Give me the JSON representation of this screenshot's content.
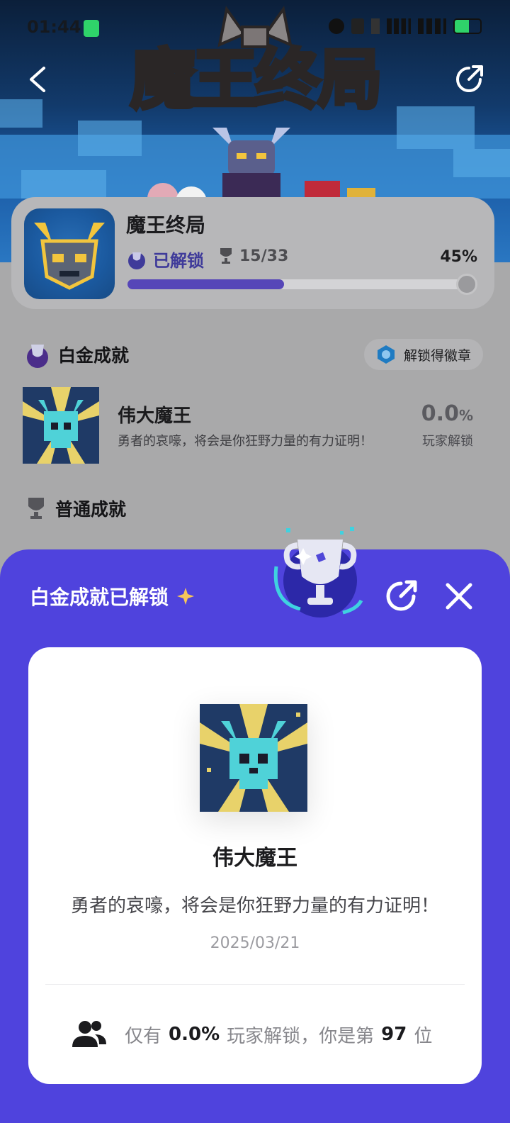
{
  "status_bar": {
    "time": "01:44"
  },
  "hero": {
    "title": "魔王终局"
  },
  "game": {
    "name": "魔王终局",
    "unlocked_label": "已解锁",
    "trophy_count": "15/33",
    "percent": "45%",
    "progress": 0.45
  },
  "platinum_section": {
    "title": "白金成就",
    "badge_button": "解锁得徽章",
    "achievement": {
      "title": "伟大魔王",
      "desc": "勇者的哀嚎，将会是你狂野力量的有力证明！",
      "pct_value": "0.0",
      "pct_unit": "%",
      "pct_label": "玩家解锁"
    }
  },
  "normal_section": {
    "title": "普通成就"
  },
  "modal": {
    "title": "白金成就已解锁",
    "card": {
      "title": "伟大魔王",
      "desc": "勇者的哀嚎，将会是你狂野力量的有力证明！",
      "date": "2025/03/21",
      "foot_prefix": "仅有",
      "foot_pct": "0.0%",
      "foot_mid": "玩家解锁，你是第",
      "foot_rank": "97",
      "foot_suffix": "位"
    }
  },
  "colors": {
    "accent": "#4f43dd",
    "progress": "#5646b8"
  }
}
